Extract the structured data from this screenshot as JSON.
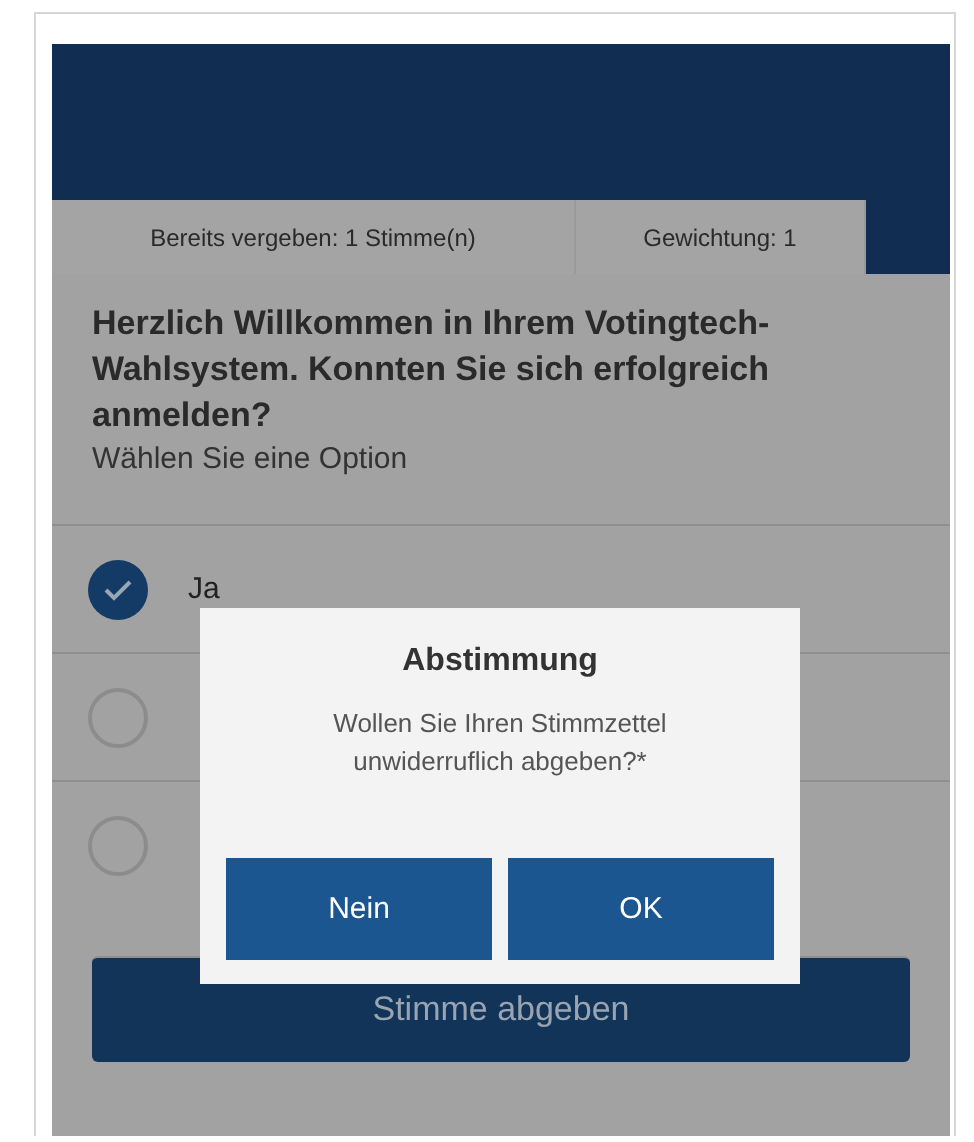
{
  "info_bar": {
    "tabs": [
      {
        "label": "Bereits vergeben: 1 Stimme(n)"
      },
      {
        "label": "Gewichtung: 1"
      }
    ]
  },
  "question": {
    "title": "Herzlich Willkommen in Ihrem Votingtech-Wahlsystem. Konnten Sie sich erfolgreich anmelden?",
    "subtitle": "Wählen Sie eine Option"
  },
  "options": [
    {
      "label": "Ja",
      "selected": true
    },
    {
      "selected": false
    },
    {
      "selected": false
    }
  ],
  "submit_button": "Stimme abgeben",
  "dialog": {
    "title": "Abstimmung",
    "message": "Wollen Sie Ihren Stimmzettel unwiderruflich abgeben?*",
    "buttons": [
      "Nein",
      "OK"
    ]
  }
}
